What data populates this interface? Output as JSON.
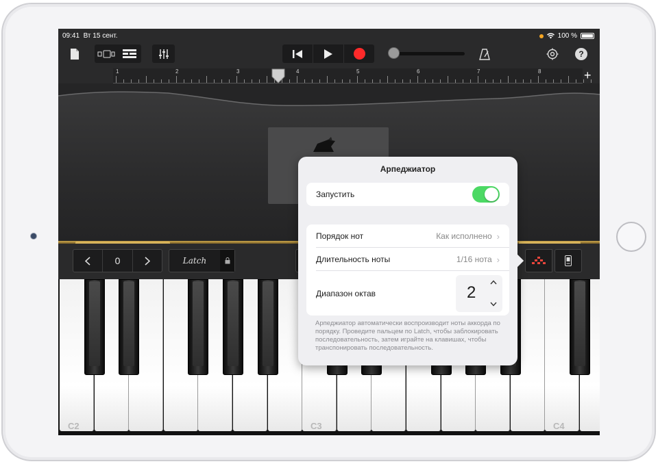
{
  "statusbar": {
    "time": "09:41",
    "date": "Вт 15 сент.",
    "battery": "100 %"
  },
  "toolbar": {
    "icons": [
      "document-icon",
      "view-toggle-icon",
      "tracks-icon",
      "mixer-icon",
      "rewind-icon",
      "play-icon",
      "record-icon",
      "metronome-icon",
      "settings-icon",
      "help-icon"
    ],
    "help_label": "?"
  },
  "ruler": {
    "bars": [
      "1",
      "2",
      "3",
      "4",
      "5",
      "6",
      "7",
      "8"
    ],
    "add_label": "+"
  },
  "keyboard_controls": {
    "octave_value": "0",
    "latch_label": "Latch"
  },
  "keyboard": {
    "labels": {
      "c2": "C2",
      "c3": "C3",
      "c4": "C4"
    }
  },
  "arpeggiator": {
    "title": "Арпеджиатор",
    "run_label": "Запустить",
    "run_enabled": true,
    "note_order_label": "Порядок нот",
    "note_order_value": "Как исполнено",
    "note_rate_label": "Длительность ноты",
    "note_rate_value": "1/16 нота",
    "octave_range_label": "Диапазон октав",
    "octave_range_value": "2",
    "footer": "Арпеджиатор автоматически воспроизводит ноты аккорда по порядку. Проведите пальцем по Latch, чтобы заблокировать последовательность, затем играйте на клавишах, чтобы транспонировать последовательность."
  },
  "colors": {
    "record": "#ff2a2a",
    "toggle_on": "#4cd964",
    "arp_icon": "#e8453c",
    "gold": "#c9a44a"
  }
}
